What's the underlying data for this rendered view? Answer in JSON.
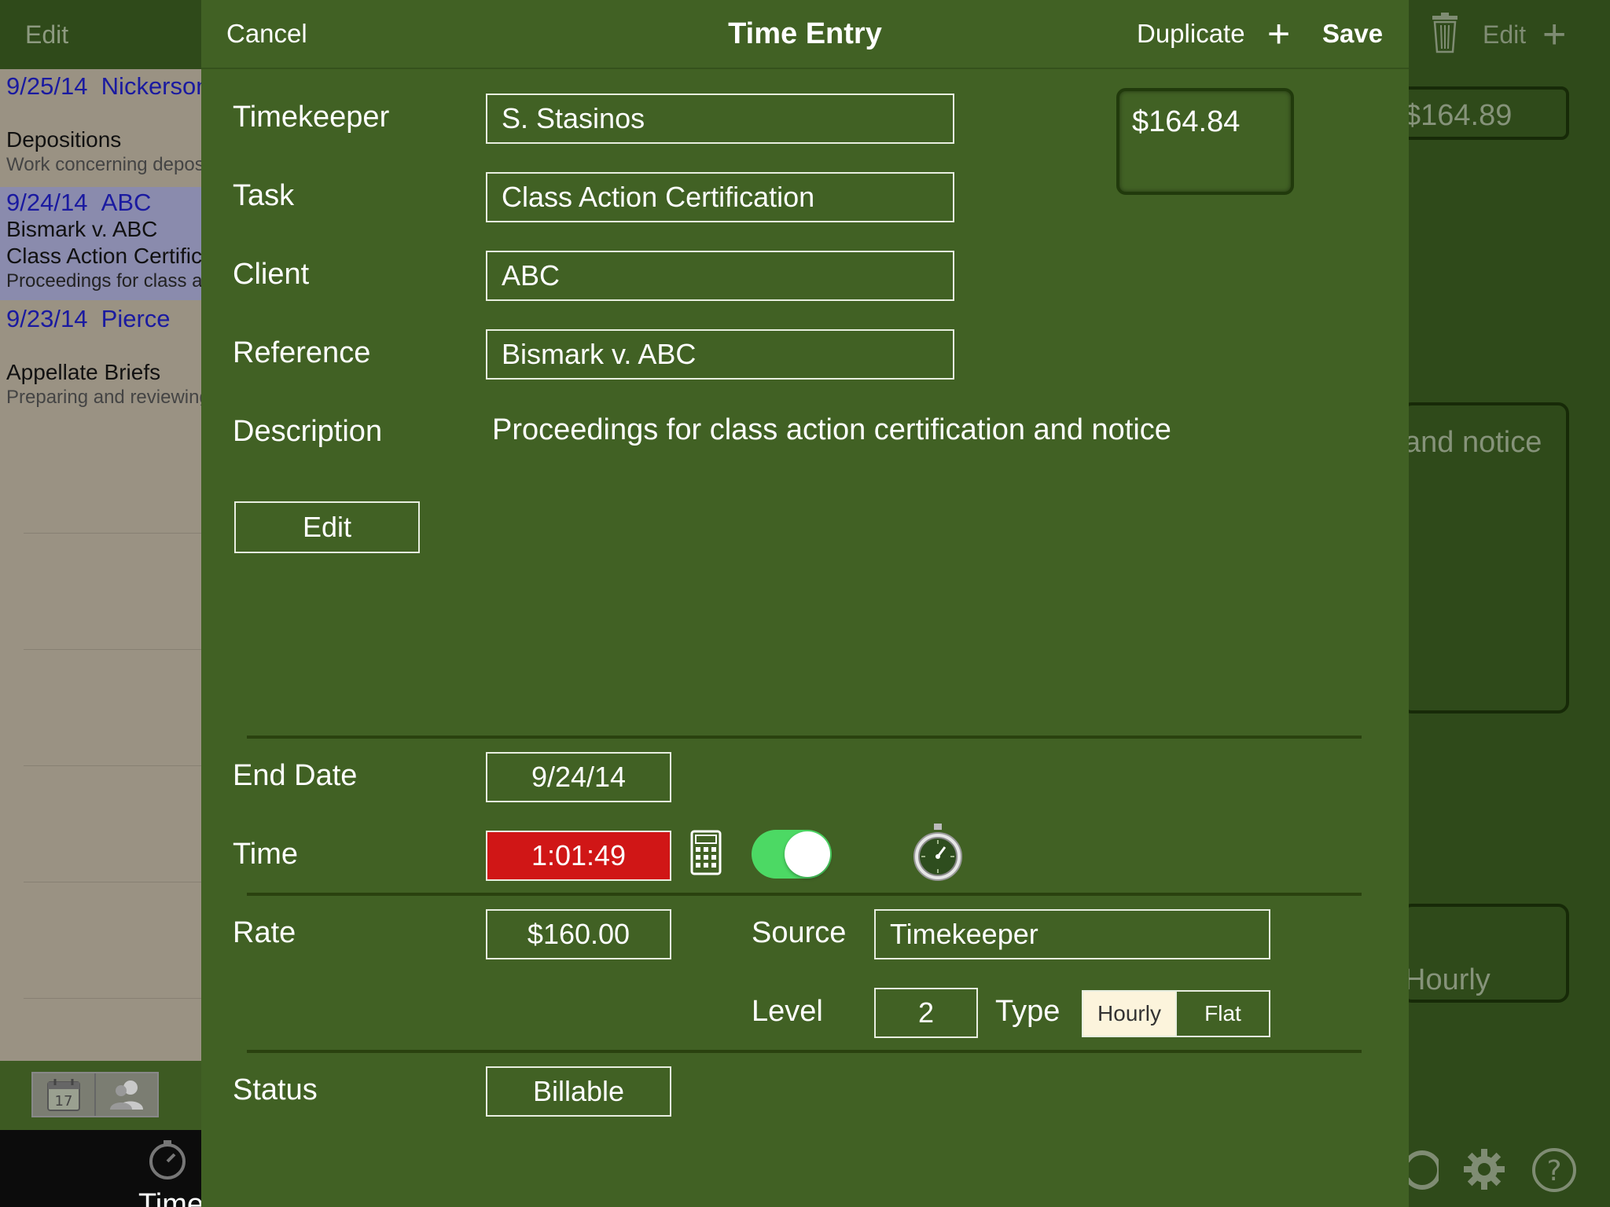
{
  "background_list": {
    "edit_label": "Edit",
    "entries": [
      {
        "date": "9/25/14",
        "client": "Nickerson",
        "task": "Depositions",
        "desc": "Work concerning depositions"
      },
      {
        "date": "9/24/14",
        "client": "ABC",
        "reference": "Bismark v. ABC",
        "task": "Class Action Certification",
        "desc": "Proceedings for class action"
      },
      {
        "date": "9/23/14",
        "client": "Pierce",
        "task": "Appellate Briefs",
        "desc": "Preparing and reviewing"
      }
    ],
    "tab_label": "Time"
  },
  "background_detail": {
    "edit_label": "Edit",
    "amount_text": "$164.89",
    "desc_text": "and notice",
    "type_text": "Hourly"
  },
  "navbar": {
    "cancel": "Cancel",
    "title": "Time Entry",
    "duplicate": "Duplicate",
    "plus": "+",
    "save": "Save"
  },
  "form": {
    "timekeeper_label": "Timekeeper",
    "timekeeper_value": "S. Stasinos",
    "task_label": "Task",
    "task_value": "Class Action Certification",
    "client_label": "Client",
    "client_value": "ABC",
    "reference_label": "Reference",
    "reference_value": "Bismark v. ABC",
    "description_label": "Description",
    "description_value": "Proceedings for class action certification and notice",
    "edit_button": "Edit",
    "amount": "$164.84",
    "end_date_label": "End Date",
    "end_date_value": "9/24/14",
    "time_label": "Time",
    "time_value": "1:01:49",
    "timer_on": true,
    "rate_label": "Rate",
    "rate_value": "$160.00",
    "source_label": "Source",
    "source_value": "Timekeeper",
    "level_label": "Level",
    "level_value": "2",
    "type_label": "Type",
    "type_options": [
      "Hourly",
      "Flat"
    ],
    "type_selected": "Hourly",
    "status_label": "Status",
    "status_value": "Billable"
  },
  "colors": {
    "sheet_bg": "#416124",
    "time_field_bg": "#d01616",
    "toggle_on": "#4cd964",
    "list_date": "#1a1aa0"
  }
}
